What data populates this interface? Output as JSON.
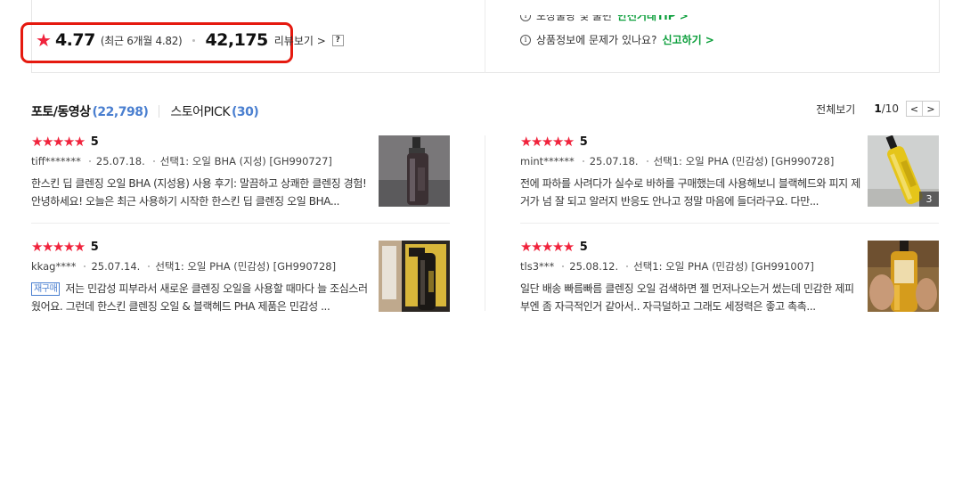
{
  "summary": {
    "star_icon": "star-filled-icon",
    "score": "4.77",
    "recent": "(최근 6개월 4.82)",
    "count": "42,175",
    "review_link": "리뷰보기 >",
    "help": "?",
    "info_top_text": "포장불량 및 불편",
    "info_top_link": "안전거래TIP >",
    "info_text": "상품정보에 문제가 있나요?",
    "info_link": "신고하기 >",
    "info_icon": "i"
  },
  "tabs": [
    {
      "label": "포토/동영상",
      "count": "(22,798)"
    },
    {
      "label": "스토어PICK",
      "count": "(30)"
    }
  ],
  "pager": {
    "all": "전체보기",
    "current": "1",
    "total": "/10",
    "prev": "<",
    "next": ">"
  },
  "reviews": [
    {
      "stars": "★★★★★",
      "score": "5",
      "user": "tiff*******",
      "date": "25.07.18.",
      "option": "선택1: 오일 BHA (지성) [GH990727]",
      "tag": "",
      "text": "한스킨 딥 클렌징 오일 BHA (지성용) 사용 후기: 말끔하고 상쾌한 클렌징 경험! 안녕하세요! 오늘은 최근 사용하기 시작한 한스킨 딥 클렌징 오일 BHA...",
      "image_count": ""
    },
    {
      "stars": "★★★★★",
      "score": "5",
      "user": "mint******",
      "date": "25.07.18.",
      "option": "선택1: 오일 PHA (민감성) [GH990728]",
      "tag": "",
      "text": "전에 파하를 사려다가 실수로 바하를 구매했는데 사용해보니 블랙헤드와 피지 제거가 넘 잘 되고 알러지 반응도 안나고 정말 마음에 들더라구요. 다만...",
      "image_count": "3"
    },
    {
      "stars": "★★★★★",
      "score": "5",
      "user": "kkag****",
      "date": "25.07.14.",
      "option": "선택1: 오일 PHA (민감성) [GH990728]",
      "tag": "재구매",
      "text": "저는 민감성 피부라서 새로운 클렌징 오일을 사용할 때마다 늘 조심스러웠어요. 그런데 한스킨 클렌징 오일 & 블랙헤드 PHA 제품은 민감성 ...",
      "image_count": ""
    },
    {
      "stars": "★★★★★",
      "score": "5",
      "user": "tls3***",
      "date": "25.08.12.",
      "option": "선택1: 오일 PHA (민감성) [GH991007]",
      "tag": "",
      "text": "일단 배송 빠름빠름 클렌징 오일 검색하면 젤 먼저나오는거 썼는데 민감한 제피부엔 좀 자극적인거 같아서.. 자극덜하고 그래도 세정력은 좋고 촉촉...",
      "image_count": ""
    }
  ],
  "colors": {
    "highlight_border": "#e5190f",
    "star": "#f0233c",
    "link_blue": "#4a7fd0",
    "link_green": "#0a9e3a"
  }
}
